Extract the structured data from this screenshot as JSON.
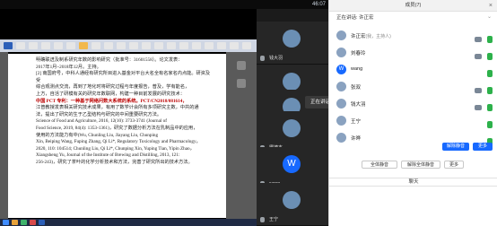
{
  "window": {
    "timer": "46:07"
  },
  "doc": {
    "lines": [
      "明确联迸及制系研究年数的影响研究（批准号：31601558）。论文发表：",
      "2017年1月~2018年12月。主持。",
      "[2] 南国府号，中科人通经有研究所目进入基金对平台大名全有名家名内点能。研资及受",
      "综合观测点交流，再到了地化时将研究过程与年度报告，普及，学有能名，",
      "上方，自活了研模有关的研究年数联网，构建一种目前发展的研究技术：",
      "中国 PCT 专利：一种基于网络问数大系统的系统。PCT/CN2018/081614，",
      "江普教授发表相关研究技术成果，有用了数学计会所有多项研究主数，中共的通",
      "法，提出了研究的生于乙型结构与研究的中间重要研究方法。"
    ],
    "refs": [
      "   Science of Food and Agriculture, 2016, 12(10): 3733-3741 (Journal of",
      "Food Science, 2019, 84(4): 1353-1361)，研究了数据分析方法在乳制品中的应用，",
      "使用的方法能力有中(Wu, Chunling Liu, Jiayang Liu, Chunping",
      "Xin, Beiping Wang, Fuping Zhang, Qi Li*, Regulatory Toxicology and Pharmacology，",
      "2020, 110: 104514; Chunling Liu, Qi Li*, Chunping Xin, Yuping Tian, Yipin Zhao，",
      "Xiangsheng Yu, Journal of the Institute of Brewing and Distilling, 2013, 121:",
      "256-243)，研究了茶叶的化学分析技术和方法，完善了研究所出的技术方法。"
    ]
  },
  "participants_col": [
    {
      "name": "钱大羽"
    },
    {
      "name": ""
    },
    {
      "name": "张双"
    },
    {
      "name": "卿德杰"
    },
    {
      "name": "wang"
    },
    {
      "name": "王宁"
    }
  ],
  "tooltip": "正在讲话: 许正宏",
  "panel": {
    "speaking": "正在讲话: 许正宏",
    "title": "成员(7)",
    "members": [
      {
        "name": "许正宏",
        "role": "(我，主持人)",
        "avatar": "",
        "cam": "on",
        "mic": "on"
      },
      {
        "name": "刘春玲",
        "role": "",
        "avatar": "",
        "cam": "on",
        "mic": "on"
      },
      {
        "name": "wang",
        "role": "",
        "avatar": "W",
        "cam": "",
        "mic": "on"
      },
      {
        "name": "张双",
        "role": "",
        "avatar": "",
        "cam": "on",
        "mic": "on"
      },
      {
        "name": "钱大羽",
        "role": "",
        "avatar": "",
        "cam": "on",
        "mic": "on"
      },
      {
        "name": "王宁",
        "role": "",
        "avatar": "",
        "cam": "",
        "mic": "on"
      },
      {
        "name": "许晔",
        "role": "",
        "avatar": "",
        "cam": "",
        "mic": "on"
      }
    ],
    "row_btn_unmute": "解除静音",
    "row_btn_more": "更多",
    "btn_mute_all": "全体静音",
    "btn_unmute_all": "解除全体静音",
    "btn_more": "更多",
    "chat_title": "聊天"
  },
  "colors": {
    "accent": "#1769ff",
    "mic_on": "#2db14b",
    "mic_off": "#e25656"
  }
}
